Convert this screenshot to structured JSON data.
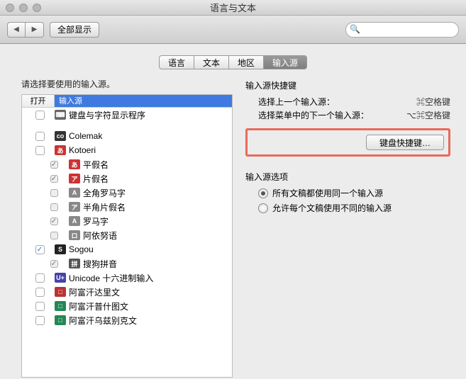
{
  "window": {
    "title": "语言与文本"
  },
  "toolbar": {
    "show_all": "全部显示",
    "search_placeholder": ""
  },
  "tabs": [
    {
      "label": "语言",
      "active": false
    },
    {
      "label": "文本",
      "active": false
    },
    {
      "label": "地区",
      "active": false
    },
    {
      "label": "输入源",
      "active": true
    }
  ],
  "left": {
    "prompt": "请选择要使用的输入源。",
    "col_open": "打开",
    "col_source": "输入源",
    "items": [
      {
        "checked": false,
        "icon_bg": "#666",
        "icon_txt": "⌨",
        "label": "键盘与字符显示程序",
        "sub": false
      },
      {
        "sep": true
      },
      {
        "checked": false,
        "icon_bg": "#333",
        "icon_txt": "co",
        "label": "Colemak",
        "sub": false
      },
      {
        "checked": false,
        "icon_bg": "#c33",
        "icon_txt": "あ",
        "label": "Kotoeri",
        "sub": false
      },
      {
        "checked": true,
        "icon_bg": "#c33",
        "icon_txt": "あ",
        "label": "平假名",
        "sub": true,
        "disabled": true
      },
      {
        "checked": true,
        "icon_bg": "#c33",
        "icon_txt": "ア",
        "label": "片假名",
        "sub": true,
        "disabled": true
      },
      {
        "checked": false,
        "icon_bg": "#888",
        "icon_txt": "A",
        "label": "全角罗马字",
        "sub": true,
        "disabled": true
      },
      {
        "checked": false,
        "icon_bg": "#888",
        "icon_txt": "ア",
        "label": "半角片假名",
        "sub": true,
        "disabled": true
      },
      {
        "checked": true,
        "icon_bg": "#888",
        "icon_txt": "A",
        "label": "罗马字",
        "sub": true,
        "disabled": true
      },
      {
        "checked": false,
        "icon_bg": "#888",
        "icon_txt": "ロ",
        "label": "阿依努语",
        "sub": true,
        "disabled": true
      },
      {
        "checked": true,
        "icon_bg": "#222",
        "icon_txt": "S",
        "label": "Sogou",
        "sub": false,
        "main_checked": true
      },
      {
        "checked": true,
        "icon_bg": "#555",
        "icon_txt": "拼",
        "label": "搜狗拼音",
        "sub": true,
        "disabled": true
      },
      {
        "checked": false,
        "icon_bg": "#44a",
        "icon_txt": "U+",
        "label": "Unicode 十六进制输入",
        "sub": false
      },
      {
        "checked": false,
        "icon_bg": "#b33",
        "icon_txt": "□",
        "label": "阿富汗达里文",
        "sub": false
      },
      {
        "checked": false,
        "icon_bg": "#285",
        "icon_txt": "□",
        "label": "阿富汗普什图文",
        "sub": false
      },
      {
        "checked": false,
        "icon_bg": "#285",
        "icon_txt": "□",
        "label": "阿富汗乌兹别克文",
        "sub": false
      }
    ]
  },
  "right": {
    "shortcut_title": "输入源快捷键",
    "kv": [
      {
        "k": "选择上一个输入源：",
        "v": "⌘空格键"
      },
      {
        "k": "选择菜单中的下一个输入源：",
        "v": "⌥⌘空格键"
      }
    ],
    "button_label": "键盘快捷键…",
    "option_title": "输入源选项",
    "radios": [
      {
        "label": "所有文稿都使用同一个输入源",
        "selected": true
      },
      {
        "label": "允许每个文稿使用不同的输入源",
        "selected": false
      }
    ]
  }
}
